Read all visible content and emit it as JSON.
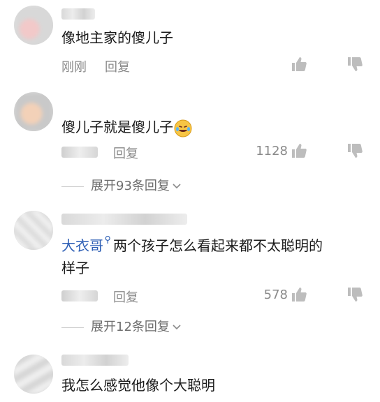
{
  "comments": [
    {
      "text": "像地主家的傻儿子",
      "time": "刚刚",
      "reply": "回复"
    },
    {
      "text": "傻儿子就是傻儿子",
      "emoji": "rofl-emoji",
      "reply": "回复",
      "like_count": "1128",
      "expand": "展开93条回复"
    },
    {
      "mention": "大衣哥",
      "text": "两个孩子怎么看起来都不太聪明的",
      "text_line2": "样子",
      "reply": "回复",
      "like_count": "578",
      "expand": "展开12条回复"
    },
    {
      "text": "我怎么感觉他像个大聪明"
    }
  ],
  "icons": {
    "like": "thumbs-up-icon",
    "dislike": "thumbs-down-icon",
    "mention": "search-mention-icon",
    "expand": "chevron-down-icon"
  },
  "colors": {
    "mention": "#2e5fb5",
    "meta": "#8a8a8a",
    "text": "#1a1a1a"
  }
}
